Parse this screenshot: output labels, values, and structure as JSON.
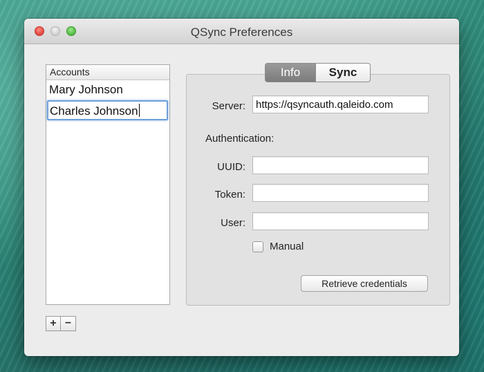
{
  "window": {
    "title": "QSync Preferences"
  },
  "accounts": {
    "header": "Accounts",
    "items": [
      "Mary Johnson",
      "Charles Johnson"
    ],
    "add_label": "+",
    "remove_label": "−"
  },
  "tabs": [
    {
      "label": "Info",
      "selected": true
    },
    {
      "label": "Sync",
      "selected": false
    }
  ],
  "info": {
    "server_label": "Server:",
    "server_value": "https://qsyncauth.qaleido.com",
    "authentication_label": "Authentication:",
    "uuid_label": "UUID:",
    "uuid_value": "",
    "token_label": "Token:",
    "token_value": "",
    "user_label": "User:",
    "user_value": "",
    "manual_label": "Manual",
    "manual_checked": false,
    "retrieve_label": "Retrieve credentials"
  },
  "colors": {
    "close": "#e0443c",
    "minimize": "#cfcfcf",
    "maximize": "#4fba3e",
    "selected_tab": "#8a8a8a",
    "focus_ring": "#6fa0d8"
  }
}
